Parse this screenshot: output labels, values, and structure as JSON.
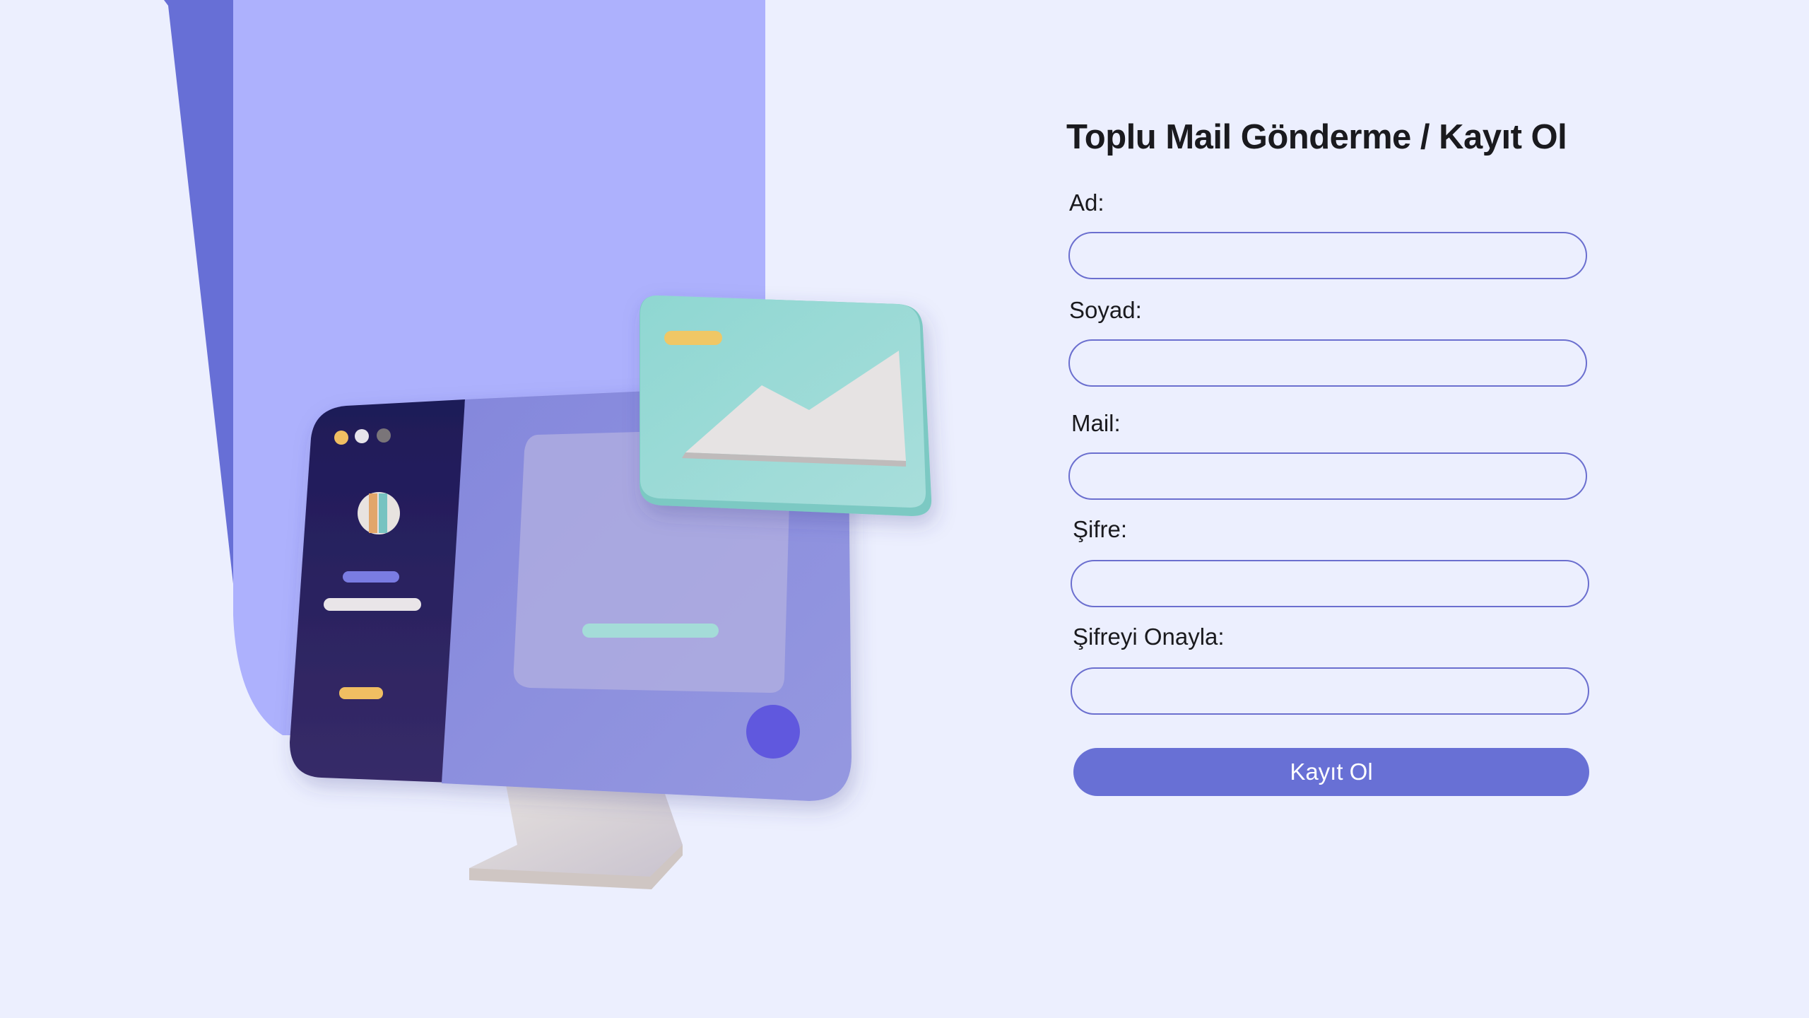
{
  "form": {
    "title": "Toplu Mail Gönderme / Kayıt Ol",
    "fields": [
      {
        "label": "Ad:",
        "value": "",
        "placeholder": ""
      },
      {
        "label": "Soyad:",
        "value": "",
        "placeholder": ""
      },
      {
        "label": "Mail:",
        "value": "",
        "placeholder": ""
      },
      {
        "label": "Şifre:",
        "value": "",
        "placeholder": ""
      },
      {
        "label": "Şifreyi Onayla:",
        "value": "",
        "placeholder": ""
      }
    ],
    "submit_label": "Kayıt Ol"
  },
  "colors": {
    "background": "#ECEFFE",
    "accent": "#6870D5",
    "input_border": "#6B6FCF",
    "illustration_panel": "#ADB1FD",
    "illustration_panel_shadow": "#676FD6",
    "monitor_sidebar": "#211B57",
    "envelope": "#8FD6D2"
  },
  "illustration": {
    "icons": [
      "monitor-icon",
      "envelope-icon",
      "image-placeholder-icon"
    ]
  }
}
